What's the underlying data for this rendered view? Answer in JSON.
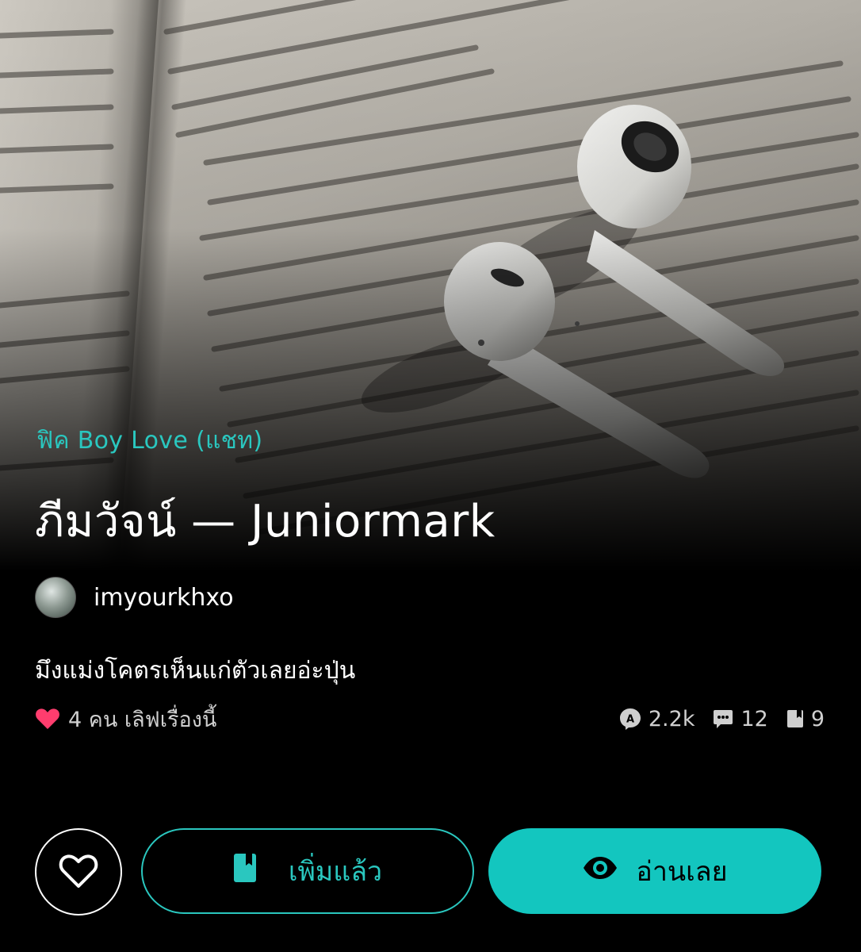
{
  "story": {
    "category": "ฟิค Boy Love (แชท)",
    "title": "ภีมวัจน์ — Juniormark",
    "author": "imyourkhxo",
    "description": "มึงแม่งโคตรเห็นแก่ตัวเลยอ่ะปุ่น"
  },
  "stats": {
    "love_text": "4 คน เลิฟเรื่องนี้",
    "reads": "2.2k",
    "comments": "12",
    "chapters": "9"
  },
  "actions": {
    "added_label": "เพิ่มแล้ว",
    "read_label": "อ่านเลย"
  },
  "icons": {
    "love": "heart-icon",
    "reads": "reads-badge-icon",
    "comments": "comment-icon",
    "chapters": "book-icon",
    "favorite": "heart-outline-icon",
    "added": "bookmark-icon",
    "read": "eye-icon"
  },
  "colors": {
    "accent": "#13c6bf",
    "heart": "#ff3d6e",
    "background": "#000000"
  }
}
